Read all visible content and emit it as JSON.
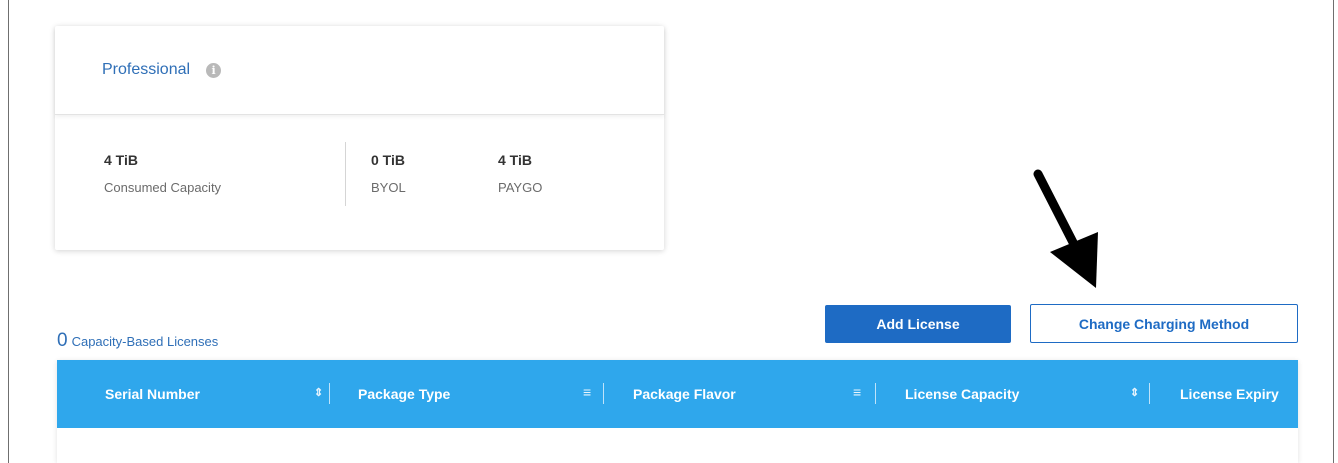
{
  "card": {
    "title": "Professional",
    "info_icon": "info-icon",
    "consumed": {
      "value": "4 TiB",
      "label": "Consumed Capacity"
    },
    "byol": {
      "value": "0 TiB",
      "label": "BYOL"
    },
    "paygo": {
      "value": "4 TiB",
      "label": "PAYGO"
    }
  },
  "licenses": {
    "count": "0",
    "label": "Capacity-Based Licenses"
  },
  "buttons": {
    "add_license": "Add License",
    "change_charging": "Change Charging Method"
  },
  "table": {
    "columns": [
      {
        "label": "Serial Number",
        "icon": "sort-icon",
        "glyph": "⇕"
      },
      {
        "label": "Package Type",
        "icon": "filter-icon",
        "glyph": "≡"
      },
      {
        "label": "Package Flavor",
        "icon": "filter-icon",
        "glyph": "≡"
      },
      {
        "label": "License Capacity",
        "icon": "sort-icon",
        "glyph": "⇕"
      },
      {
        "label": "License Expiry"
      }
    ]
  },
  "colors": {
    "accent": "#1e6bc4",
    "table_header": "#2fa7ec",
    "title_blue": "#2f6fb7"
  }
}
